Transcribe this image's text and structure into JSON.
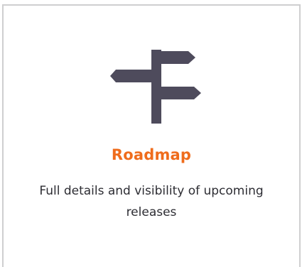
{
  "feature": {
    "icon": "signpost-icon",
    "title": "Roadmap",
    "description": "Full details and visibility of upcoming releases"
  },
  "colors": {
    "title": "#ef6c1c",
    "icon": "#4e4b5c",
    "text": "#2d2d33",
    "border": "#cfcfd0"
  }
}
